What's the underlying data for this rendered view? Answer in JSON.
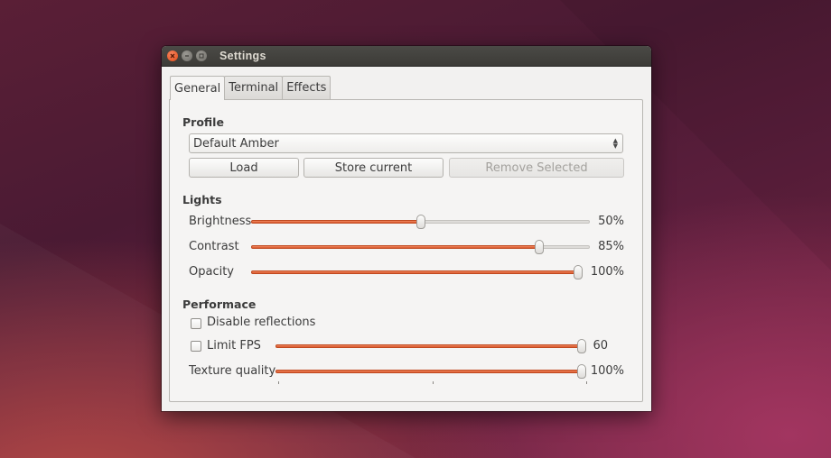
{
  "window": {
    "title": "Settings",
    "accent_color": "#dd4814"
  },
  "tabs": [
    {
      "label": "General",
      "active": true
    },
    {
      "label": "Terminal",
      "active": false
    },
    {
      "label": "Effects",
      "active": false
    }
  ],
  "profile": {
    "heading": "Profile",
    "selected": "Default Amber",
    "buttons": {
      "load": "Load",
      "store": "Store current",
      "remove": "Remove Selected"
    }
  },
  "lights": {
    "heading": "Lights",
    "brightness": {
      "label": "Brightness",
      "value_text": "50%",
      "fraction": 0.5
    },
    "contrast": {
      "label": "Contrast",
      "value_text": "85%",
      "fraction": 0.85
    },
    "opacity": {
      "label": "Opacity",
      "value_text": "100%",
      "fraction": 1.0
    }
  },
  "performance": {
    "heading": "Performace",
    "disable_reflections": {
      "label": "Disable reflections",
      "checked": false
    },
    "limit_fps": {
      "label": "Limit FPS",
      "checked": false,
      "value_text": "60",
      "fraction": 1.0
    },
    "texture_quality": {
      "label": "Texture quality",
      "value_text": "100%",
      "fraction": 1.0
    }
  }
}
